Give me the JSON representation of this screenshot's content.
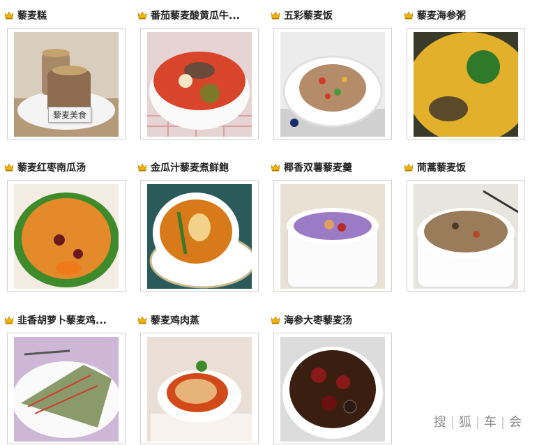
{
  "recipes": [
    {
      "title": "藜麦糕",
      "watermark": "藜麦美食"
    },
    {
      "title": "番茄藜麦酸黄瓜牛..."
    },
    {
      "title": "五彩藜麦饭"
    },
    {
      "title": "藜麦海参粥"
    },
    {
      "title": "藜麦红枣南瓜汤"
    },
    {
      "title": "金瓜汁藜麦煮鲜鲍"
    },
    {
      "title": "椰香双薯藜麦羹"
    },
    {
      "title": "茼蒿藜麦饭"
    },
    {
      "title": "韭香胡萝卜藜麦鸡..."
    },
    {
      "title": "藜麦鸡肉蒸"
    },
    {
      "title": "海参大枣藜麦汤"
    }
  ],
  "brand": {
    "c1": "搜",
    "c2": "狐",
    "c3": "车",
    "c4": "会"
  },
  "colors": {
    "crown": "#f0b400",
    "border": "#cfcfcf",
    "title": "#222222"
  }
}
